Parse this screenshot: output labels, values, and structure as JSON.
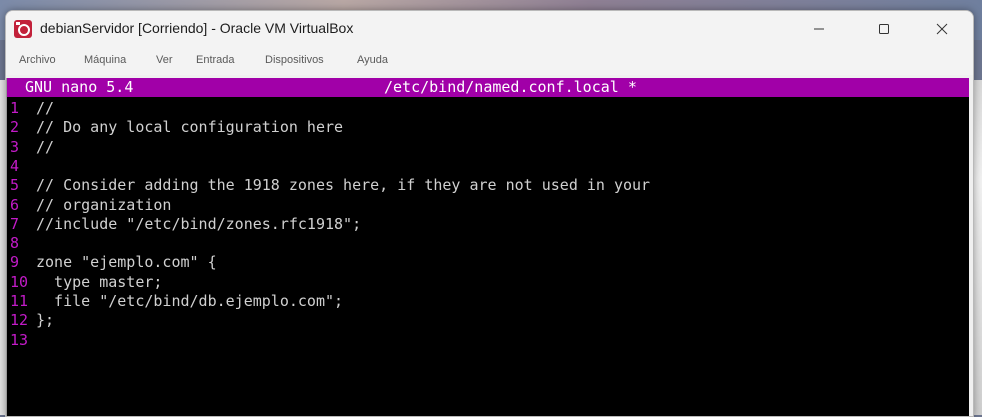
{
  "window": {
    "title": "debianServidor [Corriendo] - Oracle VM VirtualBox",
    "accent_color": "#a100a8"
  },
  "menu": {
    "items": [
      {
        "label": "Archivo"
      },
      {
        "label": "Máquina"
      },
      {
        "label": "Ver"
      },
      {
        "label": "Entrada"
      },
      {
        "label": "Dispositivos"
      },
      {
        "label": "Ayuda"
      }
    ]
  },
  "nano": {
    "app_label": "GNU nano 5.4",
    "file_label": "/etc/bind/named.conf.local *",
    "lines": [
      {
        "num": "1",
        "text": "//"
      },
      {
        "num": "2",
        "text": "// Do any local configuration here"
      },
      {
        "num": "3",
        "text": "//"
      },
      {
        "num": "4",
        "text": ""
      },
      {
        "num": "5",
        "text": "// Consider adding the 1918 zones here, if they are not used in your"
      },
      {
        "num": "6",
        "text": "// organization"
      },
      {
        "num": "7",
        "text": "//include \"/etc/bind/zones.rfc1918\";"
      },
      {
        "num": "8",
        "text": ""
      },
      {
        "num": "9",
        "text": "zone \"ejemplo.com\" {"
      },
      {
        "num": "10",
        "text": "  type master;"
      },
      {
        "num": "11",
        "text": "  file \"/etc/bind/db.ejemplo.com\";"
      },
      {
        "num": "12",
        "text": "};"
      },
      {
        "num": "13",
        "text": ""
      }
    ]
  }
}
